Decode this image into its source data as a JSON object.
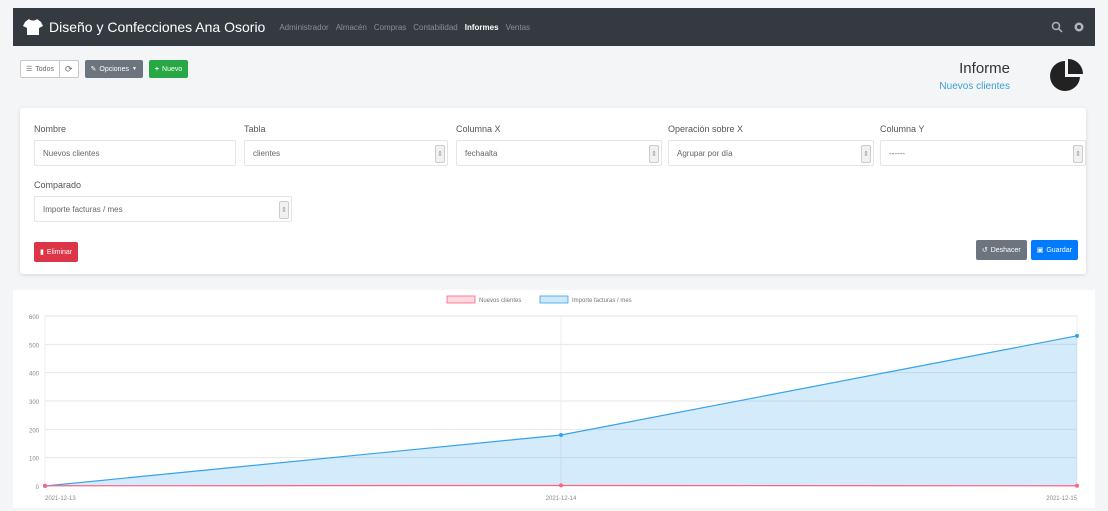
{
  "navbar": {
    "brand": "Diseño y Confecciones Ana Osorio",
    "links": [
      "Administrador",
      "Almacén",
      "Compras",
      "Contabilidad",
      "Informes",
      "Ventas"
    ],
    "active_index": 4,
    "icons": [
      "search-icon",
      "settings-icon"
    ]
  },
  "toolbar": {
    "todos_label": "Todos",
    "opciones_label": "Opciones",
    "nuevo_label": "Nuevo"
  },
  "header": {
    "title": "Informe",
    "subtitle": "Nuevos clientes"
  },
  "form": {
    "nombre": {
      "label": "Nombre",
      "value": "Nuevos clientes"
    },
    "tabla": {
      "label": "Tabla",
      "value": "clientes"
    },
    "columna_x": {
      "label": "Columna X",
      "value": "fechaalta"
    },
    "operacion_x": {
      "label": "Operación sobre X",
      "value": "Agrupar por día"
    },
    "columna_y": {
      "label": "Columna Y",
      "value": "------"
    },
    "comparado": {
      "label": "Comparado",
      "value": "Importe facturas / mes"
    },
    "eliminar_label": "Eliminar",
    "deshacer_label": "Deshacer",
    "guardar_label": "Guardar"
  },
  "colors": {
    "navbar": "#343a40",
    "danger": "#dc3545",
    "primary": "#007bff",
    "success": "#28a745",
    "secondary": "#6c757d",
    "series1": "#ff6384",
    "series2": "#36a2eb"
  },
  "chart_data": {
    "type": "area",
    "x": [
      "2021-12-13",
      "2021-12-14",
      "2021-12-15"
    ],
    "series": [
      {
        "name": "Nuevos clientes",
        "values": [
          1,
          2,
          1
        ]
      },
      {
        "name": "Importe facturas / mes",
        "values": [
          0,
          180,
          530
        ]
      }
    ],
    "ylim": [
      0,
      600
    ],
    "yticks": [
      0,
      100,
      200,
      300,
      400,
      500,
      600
    ],
    "legend": "top",
    "grid": true
  }
}
